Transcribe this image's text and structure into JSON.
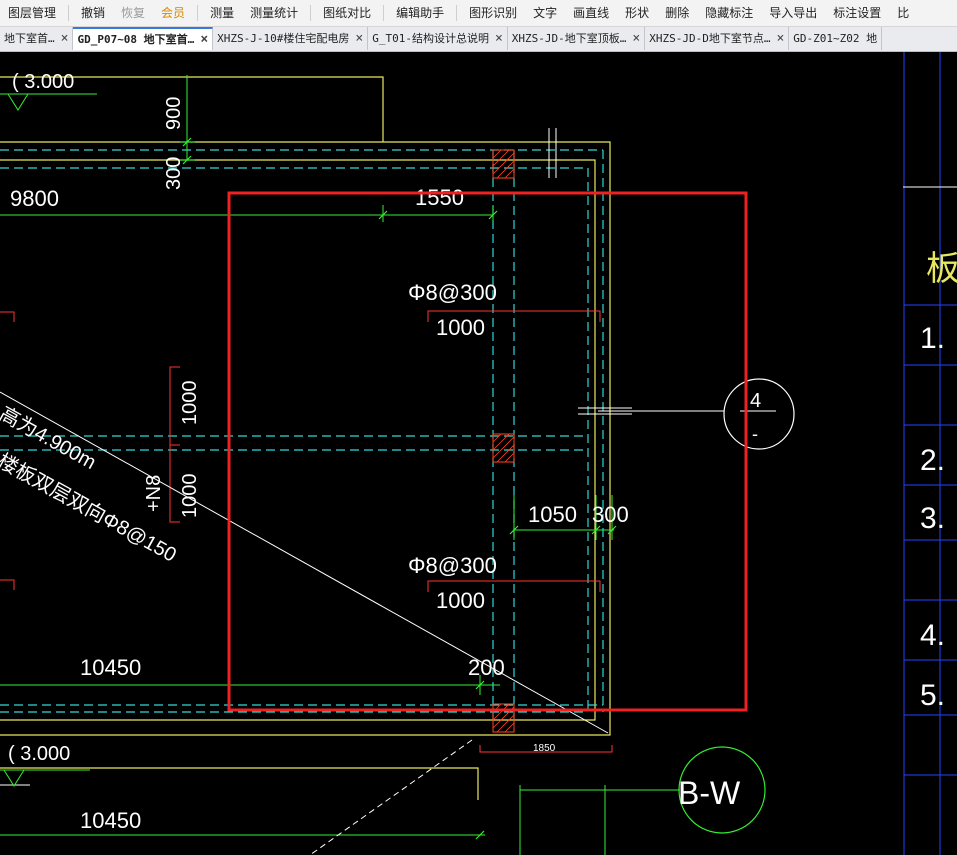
{
  "toolbar": {
    "items": [
      {
        "label": "图层管理",
        "state": "normal"
      },
      {
        "label": "撤销",
        "state": "normal"
      },
      {
        "label": "恢复",
        "state": "disabled"
      },
      {
        "label": "会员",
        "state": "accent"
      },
      {
        "label": "测量",
        "state": "normal"
      },
      {
        "label": "测量统计",
        "state": "normal"
      },
      {
        "label": "图纸对比",
        "state": "normal"
      },
      {
        "label": "编辑助手",
        "state": "normal"
      },
      {
        "label": "图形识别",
        "state": "normal"
      },
      {
        "label": "文字",
        "state": "normal"
      },
      {
        "label": "画直线",
        "state": "normal"
      },
      {
        "label": "形状",
        "state": "normal"
      },
      {
        "label": "删除",
        "state": "normal"
      },
      {
        "label": "隐藏标注",
        "state": "normal"
      },
      {
        "label": "导入导出",
        "state": "normal"
      },
      {
        "label": "标注设置",
        "state": "normal"
      },
      {
        "label": "比",
        "state": "normal"
      }
    ]
  },
  "tabs": [
    {
      "label": "地下室首…",
      "active": false,
      "close": "×"
    },
    {
      "label": "GD_P07~08 地下室首…",
      "active": true,
      "close": "×"
    },
    {
      "label": "XHZS-J-10#楼住宅配电房",
      "active": false,
      "close": "×"
    },
    {
      "label": "G_T01-结构设计总说明",
      "active": false,
      "close": "×"
    },
    {
      "label": "XHZS-JD-地下室顶板…",
      "active": false,
      "close": "×"
    },
    {
      "label": "XHZS-JD-D地下室节点…",
      "active": false,
      "close": "×"
    },
    {
      "label": "GD-Z01~Z02 地",
      "active": false,
      "close": ""
    }
  ],
  "drawing": {
    "elev_top": "( 3.000",
    "elev_bottom": "( 3.000",
    "dim_900": "900",
    "dim_300_left": "300",
    "dim_9800": "9800",
    "dim_1550": "1550",
    "rebar_top": "Φ8@300",
    "rebar_top_len": "1000",
    "dim_1000_a": "1000",
    "dim_1000_b": "1000",
    "rebar_n8": "+N8",
    "diag_text_1": "高为4.900m",
    "diag_text_2": "楼板双层双向Φ8@150",
    "dim_1050": "1050",
    "dim_300_right": "300",
    "rebar_bottom": "Φ8@300",
    "rebar_bottom_len": "1000",
    "dim_10450_a": "10450",
    "dim_200": "200",
    "dim_1850": "1850",
    "dim_10450_b": "10450",
    "detail_num": "4",
    "detail_sheet": "-",
    "axis_label": "B-W",
    "table_header": "板",
    "table_rows": [
      "1.",
      "2.",
      "3.",
      "4.",
      "5."
    ]
  },
  "colors": {
    "yellow": "#ffff66",
    "green": "#33ff33",
    "cyan": "#33dddd",
    "red": "#ff3333",
    "white": "#ffffff",
    "blue": "#2244ff",
    "highlight": "#ee2222"
  }
}
